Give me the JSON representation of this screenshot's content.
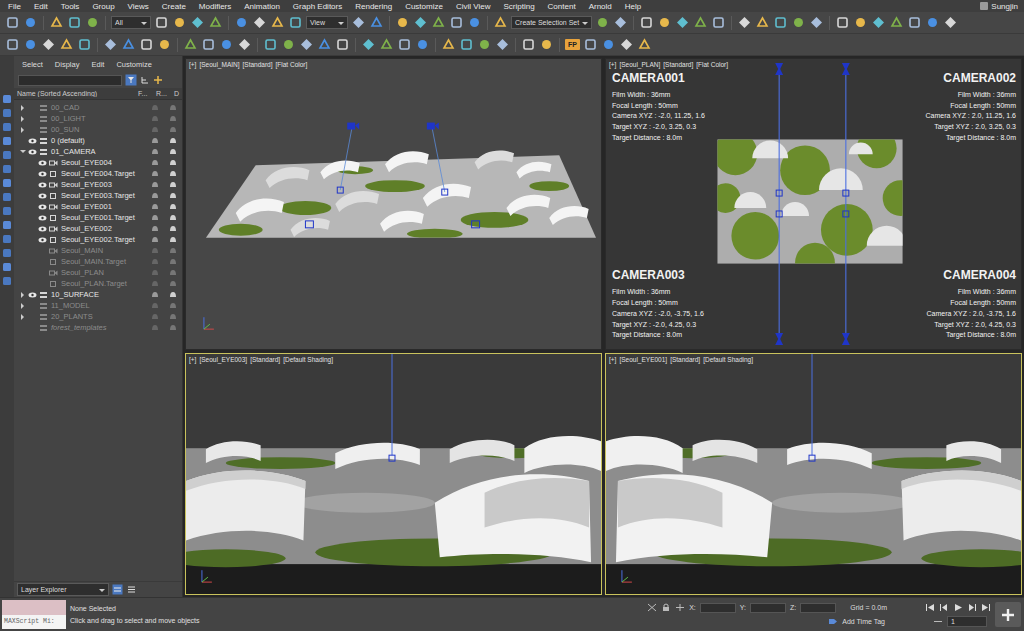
{
  "window": {
    "title": "3ds Max"
  },
  "menu": {
    "items": [
      "File",
      "Edit",
      "Tools",
      "Group",
      "Views",
      "Create",
      "Modifiers",
      "Animation",
      "Graph Editors",
      "Rendering",
      "Customize",
      "Civil View",
      "Scripting",
      "Content",
      "Arnold",
      "Help"
    ],
    "user": "Sungjin"
  },
  "toolbar": {
    "filter": "All",
    "refCoord": "View",
    "selectionSet": "Create Selection Set",
    "badge": "FP"
  },
  "explorer": {
    "tabs": [
      "Select",
      "Display",
      "Edit",
      "Customize"
    ],
    "columns": [
      "Name (Sorted Ascending)",
      "F...",
      "R...",
      "D"
    ],
    "rows": [
      {
        "name": "00_CAD",
        "depth": 0,
        "expander": "collapsed",
        "visible": false,
        "kind": "layer"
      },
      {
        "name": "00_LIGHT",
        "depth": 0,
        "expander": "collapsed",
        "visible": false,
        "kind": "layer"
      },
      {
        "name": "00_SUN",
        "depth": 0,
        "expander": "collapsed",
        "visible": false,
        "kind": "layer"
      },
      {
        "name": "0 (default)",
        "depth": 0,
        "expander": "none",
        "visible": true,
        "kind": "layer"
      },
      {
        "name": "01_CAMERA",
        "depth": 0,
        "expander": "expanded",
        "visible": true,
        "kind": "layer"
      },
      {
        "name": "Seoul_EYE004",
        "depth": 1,
        "expander": "none",
        "visible": true,
        "kind": "camera"
      },
      {
        "name": "Seoul_EYE004.Target",
        "depth": 1,
        "expander": "none",
        "visible": true,
        "kind": "target"
      },
      {
        "name": "Seoul_EYE003",
        "depth": 1,
        "expander": "none",
        "visible": true,
        "kind": "camera"
      },
      {
        "name": "Seoul_EYE003.Target",
        "depth": 1,
        "expander": "none",
        "visible": true,
        "kind": "target"
      },
      {
        "name": "Seoul_EYE001",
        "depth": 1,
        "expander": "none",
        "visible": true,
        "kind": "camera"
      },
      {
        "name": "Seoul_EYE001.Target",
        "depth": 1,
        "expander": "none",
        "visible": true,
        "kind": "target"
      },
      {
        "name": "Seoul_EYE002",
        "depth": 1,
        "expander": "none",
        "visible": true,
        "kind": "camera"
      },
      {
        "name": "Seoul_EYE002.Target",
        "depth": 1,
        "expander": "none",
        "visible": true,
        "kind": "target"
      },
      {
        "name": "Seoul_MAIN",
        "depth": 1,
        "expander": "none",
        "visible": false,
        "kind": "camera"
      },
      {
        "name": "Seoul_MAIN.Target",
        "depth": 1,
        "expander": "none",
        "visible": false,
        "kind": "target"
      },
      {
        "name": "Seoul_PLAN",
        "depth": 1,
        "expander": "none",
        "visible": false,
        "kind": "camera"
      },
      {
        "name": "Seoul_PLAN.Target",
        "depth": 1,
        "expander": "none",
        "visible": false,
        "kind": "target"
      },
      {
        "name": "10_SURFACE",
        "depth": 0,
        "expander": "collapsed",
        "visible": true,
        "kind": "layer"
      },
      {
        "name": "11_MODEL",
        "depth": 0,
        "expander": "collapsed",
        "visible": false,
        "kind": "layer"
      },
      {
        "name": "20_PLANTS",
        "depth": 0,
        "expander": "collapsed",
        "visible": false,
        "kind": "layer"
      },
      {
        "name": "forest_templates",
        "depth": 0,
        "expander": "none",
        "visible": false,
        "kind": "template"
      }
    ],
    "footer": "Layer Explorer"
  },
  "viewports": [
    {
      "label": [
        "[+]",
        "[Seoul_MAIN]",
        "[Standard]",
        "[Flat Color]"
      ],
      "kind": "perspective",
      "active": false
    },
    {
      "label": [
        "[+]",
        "[Seoul_PLAN]",
        "[Standard]",
        "[Flat Color]"
      ],
      "kind": "plan",
      "active": false
    },
    {
      "label": [
        "[+]",
        "[Seoul_EYE003]",
        "[Standard]",
        "[Default Shading]"
      ],
      "kind": "eye",
      "active": true
    },
    {
      "label": [
        "[+]",
        "[Seoul_EYE001]",
        "[Standard]",
        "[Default Shading]"
      ],
      "kind": "eye",
      "active": true
    }
  ],
  "cameras": [
    {
      "title": "CAMERA001",
      "lines": [
        "Film Width : 36mm",
        "Focal Length : 50mm",
        "Camera XYZ : -2.0, 11.25, 1.6",
        "Target XYZ : -2.0, 3.25, 0.3",
        "Target Distance : 8.0m"
      ]
    },
    {
      "title": "CAMERA002",
      "lines": [
        "Film Width : 36mm",
        "Focal Length : 50mm",
        "Camera XYZ : 2.0, 11.25, 1.6",
        "Target XYZ : 2.0, 3.25, 0.3",
        "Target Distance : 8.0m"
      ]
    },
    {
      "title": "CAMERA003",
      "lines": [
        "Film Width : 36mm",
        "Focal Length : 50mm",
        "Camera XYZ : -2.0, -3.75, 1.6",
        "Target XYZ : -2.0, 4.25, 0.3",
        "Target Distance : 8.0m"
      ]
    },
    {
      "title": "CAMERA004",
      "lines": [
        "Film Width : 36mm",
        "Focal Length : 50mm",
        "Camera XYZ : 2.0, -3.75, 1.6",
        "Target XYZ : 2.0, 4.25, 0.3",
        "Target Distance : 8.0m"
      ]
    }
  ],
  "status": {
    "maxscript": "MAXScript Mi:",
    "selection": "None Selected",
    "prompt": "Click and drag to select and move objects",
    "coords": [
      "X:",
      "Y:",
      "Z:"
    ],
    "grid": "Grid = 0.0m",
    "timeTag": "Add Time Tag",
    "frame": "1"
  }
}
